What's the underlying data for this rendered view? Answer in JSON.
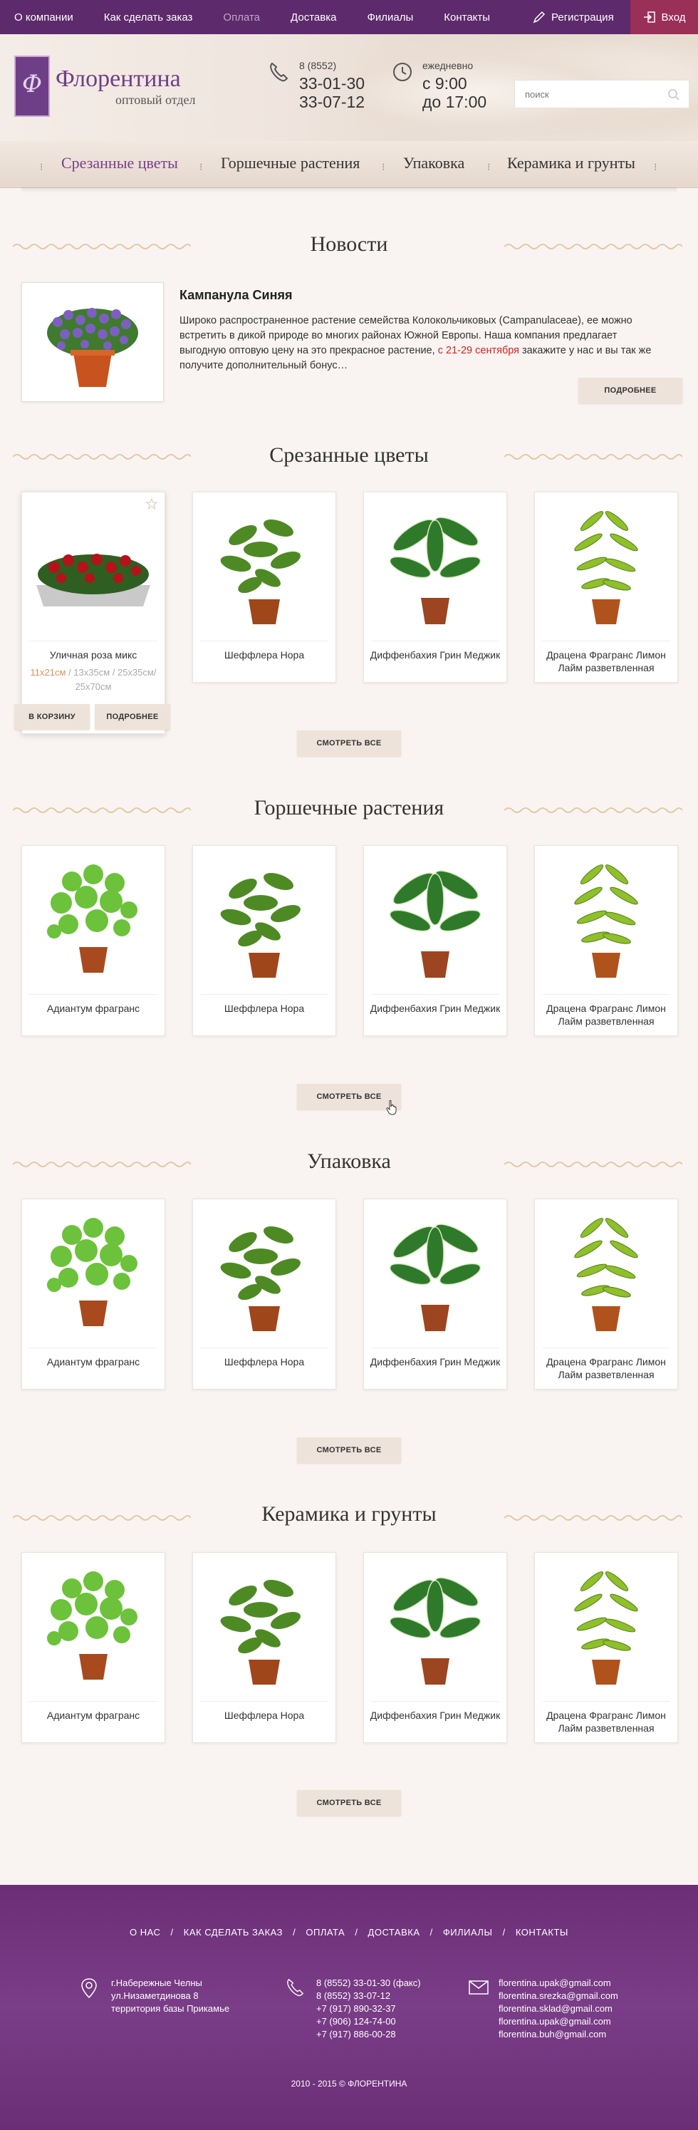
{
  "topnav": {
    "items": [
      "О компании",
      "Как сделать заказ",
      "Оплата",
      "Доставка",
      "Филиалы",
      "Контакты"
    ],
    "register": "Регистрация",
    "login": "Вход"
  },
  "header": {
    "logo_letters": "Ф",
    "brand": "Флорентина",
    "brand_sub": "оптовый отдел",
    "phone_code": "8 (8552)",
    "phone1": "33-01-30",
    "phone2": "33-07-12",
    "hours_label": "ежедневно",
    "hours_from": "с 9:00",
    "hours_to": "до 17:00",
    "search_placeholder": "поиск"
  },
  "catnav": [
    "Срезанные цветы",
    "Горшечные растения",
    "Упаковка",
    "Керамика и грунты"
  ],
  "news": {
    "title": "Новости",
    "item_title": "Кампанула Синяя",
    "text_before": "Широко распространенное растение семейства Колокольчиковых (Campanulaceae), ее можно встретить в дикой природе во многих районах Южной Европы. Наша компания предлагает выгодную оптовую цену на это прекрасное растение, ",
    "text_highlight": "с 21-29 сентября",
    "text_after": " закажите у нас и вы так же получите дополнительный бонус…",
    "more_button": "Подробнее"
  },
  "sections": [
    {
      "title": "Срезанные цветы",
      "products": [
        "Уличная роза микс",
        "Шеффлера Нора",
        "Диффенбахия Грин Меджик",
        "Драцена Фрагранс Лимон Лайм разветвленная"
      ],
      "sizes_selected": "11x21см",
      "sizes_rest": " / 13x35см / 25x35см/ 25x70см",
      "cart_button": "В корзину",
      "more_button": "Подробнее",
      "view_all": "Смотреть все"
    },
    {
      "title": "Горшечные растения",
      "products": [
        "Адиантум фрагранс",
        "Шеффлера Нора",
        "Диффенбахия Грин Меджик",
        "Драцена Фрагранс Лимон Лайм разветвленная"
      ],
      "view_all": "Смотреть все"
    },
    {
      "title": "Упаковка",
      "products": [
        "Адиантум фрагранс",
        "Шеффлера Нора",
        "Диффенбахия Грин Меджик",
        "Драцена Фрагранс Лимон Лайм разветвленная"
      ],
      "view_all": "Смотреть все"
    },
    {
      "title": "Керамика и грунты",
      "products": [
        "Адиантум фрагранс",
        "Шеффлера Нора",
        "Диффенбахия Грин Меджик",
        "Драцена Фрагранс Лимон Лайм разветвленная"
      ],
      "view_all": "Смотреть все"
    }
  ],
  "footer": {
    "nav": [
      "О НАС",
      "КАК СДЕЛАТЬ ЗАКАЗ",
      "ОПЛАТА",
      "ДОСТАВКА",
      "ФИЛИАЛЫ",
      "КОНТАКТЫ"
    ],
    "address": [
      "г.Набережные Челны",
      "ул.Низаметдинова 8",
      "территория базы Прикамье"
    ],
    "phones": [
      "8 (8552) 33-01-30 (факс)",
      "8 (8552) 33-07-12",
      "+7 (917) 890-32-37",
      "+7 (906) 124-74-00",
      "+7 (917) 886-00-28"
    ],
    "emails": [
      "florentina.upak@gmail.com",
      "florentina.srezka@gmail.com",
      "florentina.sklad@gmail.com",
      "florentina.upak@gmail.com",
      "florentina.buh@gmail.com"
    ],
    "copyright": "2010 - 2015 © ФЛОРЕНТИНА"
  },
  "colors": {
    "brand_purple": "#5d2a6b",
    "login_bg": "#9a2f58",
    "highlight_red": "#d62020",
    "page_bg": "#f9f4f1"
  }
}
